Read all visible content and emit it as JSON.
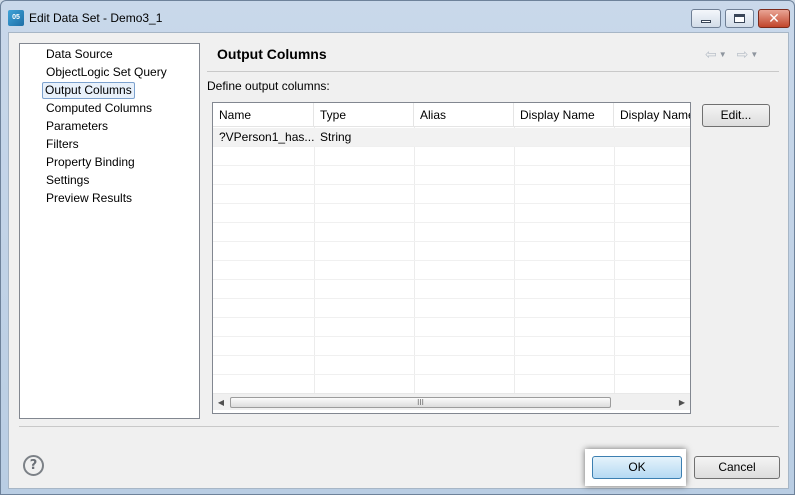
{
  "window": {
    "title": "Edit Data Set - Demo3_1",
    "app_icon_text": "05"
  },
  "nav": {
    "items": [
      {
        "label": "Data Source"
      },
      {
        "label": "ObjectLogic Set Query"
      },
      {
        "label": "Output Columns",
        "selected": true
      },
      {
        "label": "Computed Columns"
      },
      {
        "label": "Parameters"
      },
      {
        "label": "Filters"
      },
      {
        "label": "Property Binding"
      },
      {
        "label": "Settings"
      },
      {
        "label": "Preview Results"
      }
    ]
  },
  "page": {
    "title": "Output Columns",
    "define_label": "Define output columns:"
  },
  "table": {
    "columns": [
      "Name",
      "Type",
      "Alias",
      "Display Name",
      "Display Name"
    ],
    "rows": [
      [
        "?VPerson1_has...",
        "String",
        "",
        "",
        ""
      ]
    ],
    "scroll_thumb_glyph": "III"
  },
  "buttons": {
    "edit": "Edit...",
    "ok": "OK",
    "cancel": "Cancel",
    "help": "?"
  },
  "colors": {
    "ok_accent": "#3c7fb1",
    "titlebar": "#c9d8ea",
    "close_button": "#c1452b"
  },
  "icons": {
    "back": "arrow-left-icon",
    "forward": "arrow-right-icon",
    "help": "question-circle-icon"
  }
}
